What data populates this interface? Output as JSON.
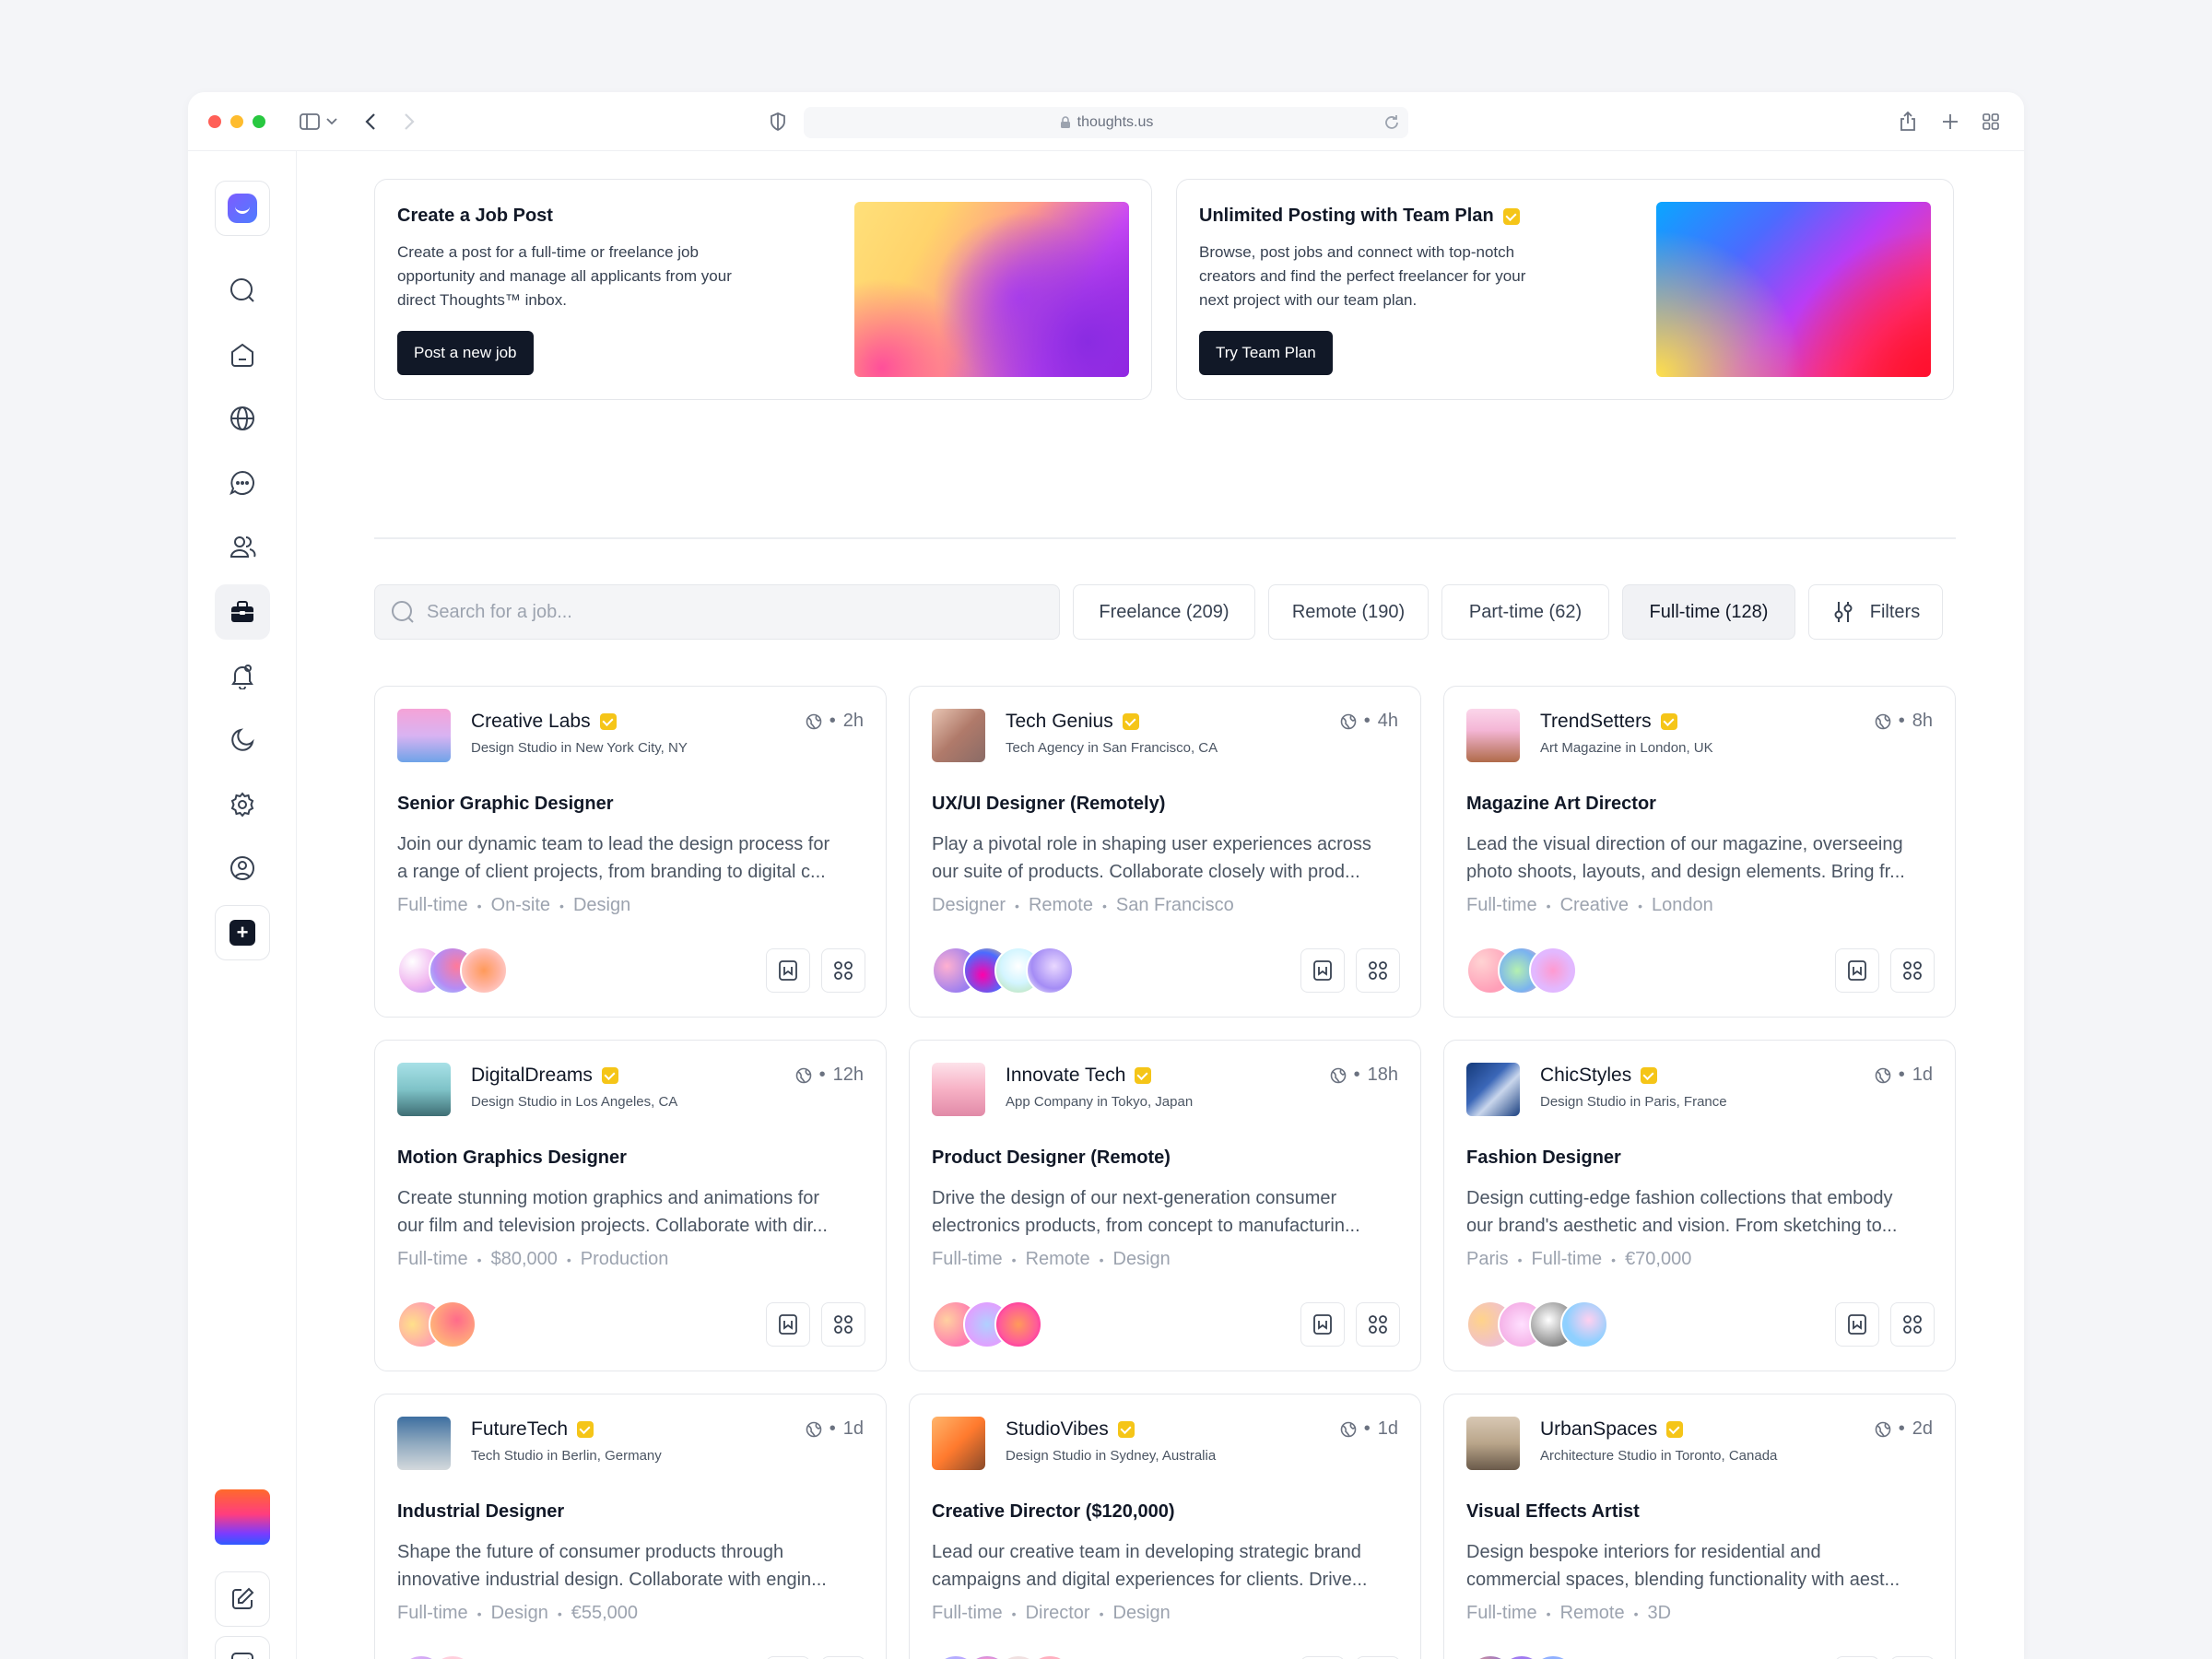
{
  "browser": {
    "url": "thoughts.us"
  },
  "promos": [
    {
      "title": "Create a Job Post",
      "description": [
        "Create a post for a full-time or freelance job",
        "opportunity and manage all applicants from your",
        "direct Thoughts™ inbox."
      ],
      "button": "Post a new job"
    },
    {
      "title": "Unlimited Posting with Team Plan",
      "description": [
        "Browse, post jobs and connect with top-notch",
        "creators and find the perfect freelancer for your",
        "next project with our team plan."
      ],
      "button": "Try Team Plan"
    }
  ],
  "search": {
    "placeholder": "Search for a job..."
  },
  "filters": [
    "Freelance (209)",
    "Remote (190)",
    "Part-time (62)",
    "Full-time (128)"
  ],
  "filters_button": "Filters",
  "jobs": [
    {
      "company": "Creative Labs",
      "location": "Design Studio in  New York City, NY",
      "time": "2h",
      "title": "Senior Graphic Designer",
      "desc": [
        "Join our dynamic team to lead the design process for",
        "a range of client projects, from branding to digital c..."
      ],
      "tags": [
        "Full-time",
        "On-site",
        "Design"
      ]
    },
    {
      "company": "Tech Genius",
      "location": "Tech Agency in San Francisco, CA",
      "time": "4h",
      "title": "UX/UI Designer (Remotely)",
      "desc": [
        "Play a pivotal role in shaping user experiences across",
        "our suite of products. Collaborate closely with prod..."
      ],
      "tags": [
        "Designer",
        "Remote",
        "San Francisco"
      ]
    },
    {
      "company": "TrendSetters",
      "location": "Art Magazine in London, UK",
      "time": "8h",
      "title": "Magazine Art Director",
      "desc": [
        "Lead the visual direction of our magazine, overseeing",
        "photo shoots, layouts, and design elements. Bring fr..."
      ],
      "tags": [
        "Full-time",
        "Creative",
        "London"
      ]
    },
    {
      "company": "DigitalDreams",
      "location": "Design Studio in Los Angeles, CA",
      "time": "12h",
      "title": "Motion Graphics Designer",
      "desc": [
        "Create stunning motion graphics and animations for",
        "our film and television projects. Collaborate with dir..."
      ],
      "tags": [
        "Full-time",
        "$80,000",
        "Production"
      ]
    },
    {
      "company": "Innovate Tech",
      "location": "App Company in Tokyo, Japan",
      "time": "18h",
      "title": "Product Designer (Remote)",
      "desc": [
        "Drive the design of our next-generation consumer",
        "electronics products, from concept to manufacturin..."
      ],
      "tags": [
        "Full-time",
        "Remote",
        "Design"
      ]
    },
    {
      "company": "ChicStyles",
      "location": "Design Studio in Paris, France",
      "time": "1d",
      "title": "Fashion Designer",
      "desc": [
        "Design cutting-edge fashion collections that embody",
        "our brand's aesthetic and vision. From sketching to..."
      ],
      "tags": [
        "Paris",
        "Full-time",
        "€70,000"
      ]
    },
    {
      "company": "FutureTech",
      "location": "Tech Studio in Berlin, Germany",
      "time": "1d",
      "title": "Industrial Designer",
      "desc": [
        "Shape the future of consumer products through",
        "innovative industrial design. Collaborate with engin..."
      ],
      "tags": [
        "Full-time",
        "Design",
        "€55,000"
      ]
    },
    {
      "company": "StudioVibes",
      "location": "Design Studio in Sydney, Australia",
      "time": "1d",
      "title": "Creative Director ($120,000)",
      "desc": [
        "Lead our creative team in developing strategic brand",
        "campaigns and digital experiences for clients. Drive..."
      ],
      "tags": [
        "Full-time",
        "Director",
        "Design"
      ]
    },
    {
      "company": "UrbanSpaces",
      "location": "Architecture Studio in Toronto, Canada",
      "time": "2d",
      "title": "Visual Effects Artist",
      "desc": [
        "Design bespoke interiors for residential and",
        "commercial spaces, blending functionality with aest..."
      ],
      "tags": [
        "Full-time",
        "Remote",
        "3D"
      ]
    }
  ],
  "colors": {
    "accent_dark": "#111827",
    "verified": "#f5c518",
    "traffic_red": "#ff5f57",
    "traffic_yellow": "#febc2e",
    "traffic_green": "#28c840"
  },
  "icons": {
    "sidebar": [
      "logo",
      "search-icon",
      "home-icon",
      "globe-icon",
      "chat-icon",
      "users-icon",
      "briefcase-icon",
      "bell-icon",
      "moon-icon",
      "gear-icon",
      "user-circle-icon",
      "plus-icon",
      "edit-icon",
      "chart-icon"
    ]
  }
}
